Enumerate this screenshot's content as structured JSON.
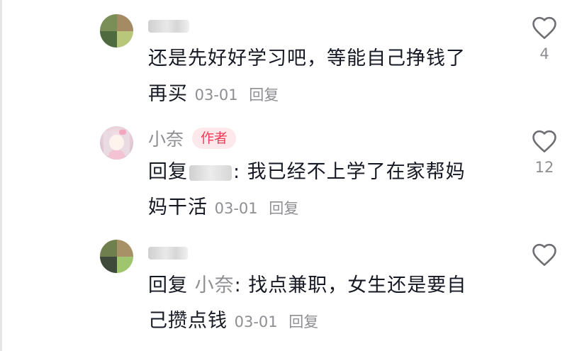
{
  "comments": [
    {
      "username": "",
      "text_line1": "还是先好好学习吧，等能自己挣钱了",
      "text_line2": "再买",
      "date": "03-01",
      "reply_label": "回复",
      "likes": "4",
      "avatar_colors": [
        "#7a8f58",
        "#a58b64",
        "#4f6a3e",
        "#b8c77a"
      ]
    },
    {
      "username": "小奈",
      "badge": "作者",
      "reply_prefix": "回复",
      "reply_suffix": ": 我已经不上学了在家帮妈",
      "text_line2": "妈干活",
      "date": "03-01",
      "reply_label": "回复",
      "likes": "12"
    },
    {
      "username": "",
      "reply_prefix": "回复",
      "reply_to": "小奈",
      "reply_suffix": ": 找点兼职，女生还是要自",
      "text_line2": "己攒点钱",
      "date": "03-01",
      "reply_label": "回复",
      "likes": "",
      "avatar_colors": [
        "#6f7f4d",
        "#a89166",
        "#3f4a3a",
        "#9fc56e"
      ]
    }
  ],
  "icons": {
    "like": "heart-outline-icon"
  },
  "colors": {
    "text": "#161823",
    "muted": "#8e8e93",
    "badge_bg": "#fde8ec",
    "badge_text": "#f23a56"
  }
}
